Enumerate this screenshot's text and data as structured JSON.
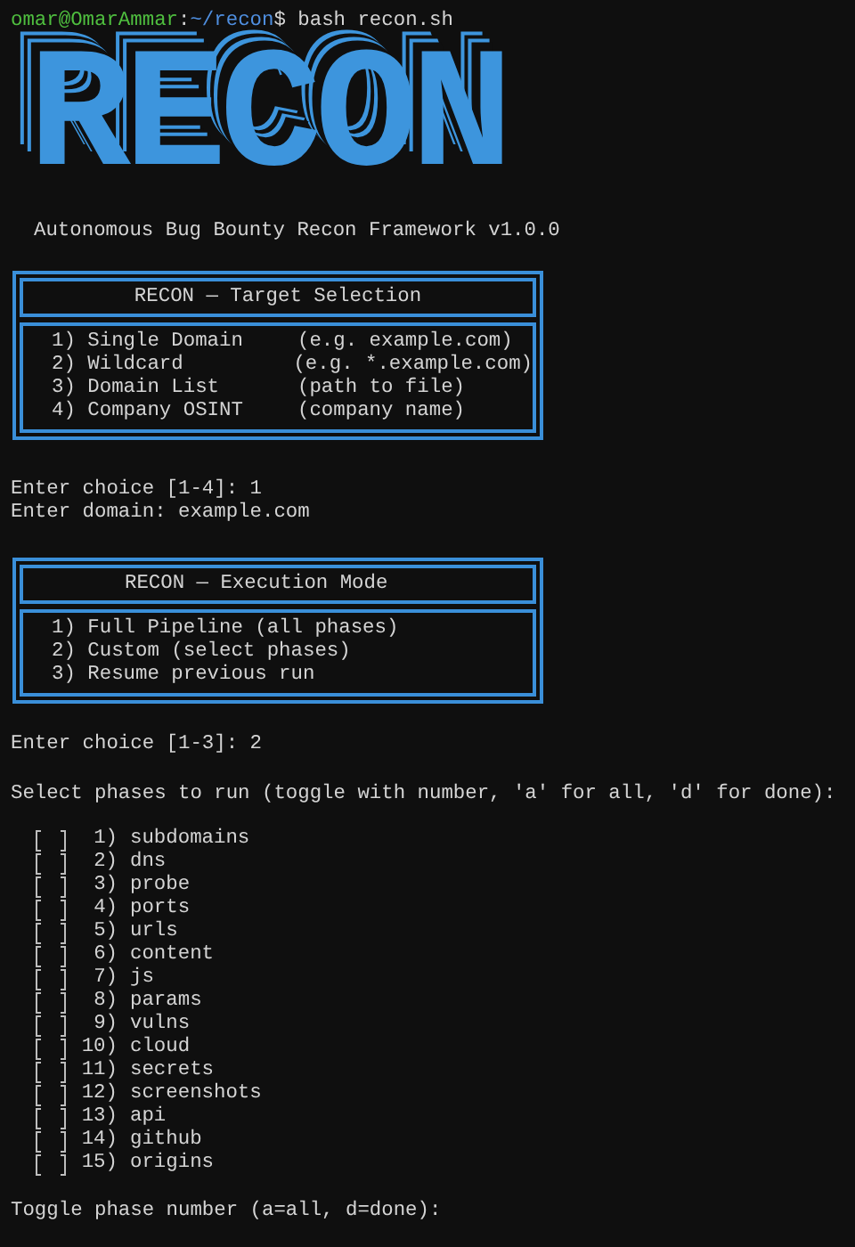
{
  "prompt": {
    "user": "omar@OmarAmmar",
    "separator": ":",
    "path": "~/recon",
    "command": "$ bash recon.sh"
  },
  "logo": {
    "text": "RECON"
  },
  "subtitle": "Autonomous Bug Bounty Recon Framework v1.0.0",
  "target_menu": {
    "title": "RECON — Target Selection",
    "options": [
      {
        "label": "1) Single Domain",
        "hint": "(e.g. example.com)"
      },
      {
        "label": "2) Wildcard",
        "hint": "(e.g. *.example.com)"
      },
      {
        "label": "3) Domain List",
        "hint": "(path to file)"
      },
      {
        "label": "4) Company OSINT",
        "hint": "(company name)"
      }
    ]
  },
  "target_input": [
    "Enter choice [1-4]: 1",
    "Enter domain: example.com"
  ],
  "mode_menu": {
    "title": "RECON — Execution Mode",
    "options": [
      "1) Full Pipeline (all phases)",
      "2) Custom (select phases)",
      "3) Resume previous run"
    ]
  },
  "mode_input": "Enter choice [1-3]: 2",
  "phase_prompt": "Select phases to run (toggle with number, 'a' for all, 'd' for done):",
  "phases": [
    {
      "number": "1)",
      "name": "subdomains",
      "checked": false
    },
    {
      "number": "2)",
      "name": "dns",
      "checked": false
    },
    {
      "number": "3)",
      "name": "probe",
      "checked": false
    },
    {
      "number": "4)",
      "name": "ports",
      "checked": false
    },
    {
      "number": "5)",
      "name": "urls",
      "checked": false
    },
    {
      "number": "6)",
      "name": "content",
      "checked": false
    },
    {
      "number": "7)",
      "name": "js",
      "checked": false
    },
    {
      "number": "8)",
      "name": "params",
      "checked": false
    },
    {
      "number": "9)",
      "name": "vulns",
      "checked": false
    },
    {
      "number": "10)",
      "name": "cloud",
      "checked": false
    },
    {
      "number": "11)",
      "name": "secrets",
      "checked": false
    },
    {
      "number": "12)",
      "name": "screenshots",
      "checked": false
    },
    {
      "number": "13)",
      "name": "api",
      "checked": false
    },
    {
      "number": "14)",
      "name": "github",
      "checked": false
    },
    {
      "number": "15)",
      "name": "origins",
      "checked": false
    }
  ],
  "toggle_prompt": "Toggle phase number (a=all, d=done):"
}
